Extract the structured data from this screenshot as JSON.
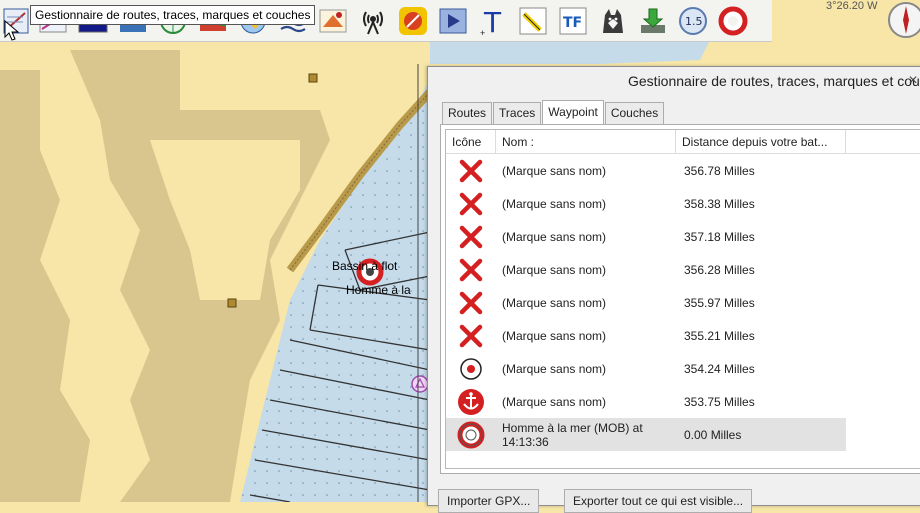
{
  "toolbar": {
    "tooltip": "Gestionnaire de routes, traces, marques et couches",
    "buttons": [
      {
        "name": "route-manager-icon"
      },
      {
        "name": "route-icon"
      },
      {
        "name": "blue-rect-icon"
      },
      {
        "name": "chart-icon"
      },
      {
        "name": "radar-icon"
      },
      {
        "name": "layers-icon"
      },
      {
        "name": "globe-icon"
      },
      {
        "name": "waves-icon"
      },
      {
        "name": "ais-icon"
      },
      {
        "name": "antenna-icon"
      },
      {
        "name": "settings-icon"
      },
      {
        "name": "play-icon"
      },
      {
        "name": "text-tool-icon"
      },
      {
        "name": "pencil-icon"
      },
      {
        "name": "tf-icon"
      },
      {
        "name": "dog-icon"
      },
      {
        "name": "download-icon"
      },
      {
        "name": "zoom-level-icon"
      },
      {
        "name": "lifebuoy-icon"
      }
    ],
    "zoom_level": "1.5",
    "tf_label": "TF",
    "text_tool_label": "T"
  },
  "map": {
    "coordinate_readout": "3°26.20 W",
    "label_basin": "Bassin à flot",
    "label_mob": "Homme à la"
  },
  "dialog": {
    "title": "Gestionnaire de routes, traces, marques et couches",
    "close": "×",
    "tabs": [
      {
        "label": "Routes",
        "active": false
      },
      {
        "label": "Traces",
        "active": false
      },
      {
        "label": "Waypoint",
        "active": true
      },
      {
        "label": "Couches",
        "active": false
      }
    ],
    "columns": {
      "icon": "Icône",
      "name": "Nom :",
      "distance": "Distance depuis votre bat..."
    },
    "rows": [
      {
        "icon": "cross-icon",
        "name": "(Marque sans nom)",
        "distance": "356.78 Milles"
      },
      {
        "icon": "cross-icon",
        "name": "(Marque sans nom)",
        "distance": "358.38 Milles"
      },
      {
        "icon": "cross-icon",
        "name": "(Marque sans nom)",
        "distance": "357.18 Milles"
      },
      {
        "icon": "cross-icon",
        "name": "(Marque sans nom)",
        "distance": "356.28 Milles"
      },
      {
        "icon": "cross-icon",
        "name": "(Marque sans nom)",
        "distance": "355.97 Milles"
      },
      {
        "icon": "cross-icon",
        "name": "(Marque sans nom)",
        "distance": "355.21 Milles"
      },
      {
        "icon": "target-icon",
        "name": "(Marque sans nom)",
        "distance": "354.24 Milles"
      },
      {
        "icon": "anchor-icon",
        "name": "(Marque sans nom)",
        "distance": "353.75 Milles"
      },
      {
        "icon": "lifebuoy-icon",
        "name": "Homme à la mer (MOB) at 14:13:36",
        "distance": "0.00 Milles"
      }
    ],
    "buttons": {
      "import": "Importer GPX...",
      "export": "Exporter tout ce qui est visible..."
    }
  },
  "colors": {
    "land": "#f7e6a8",
    "land_dark": "#d9c68f",
    "water": "#c5dbea",
    "coast": "#b99a4a",
    "cross": "#d42020"
  }
}
